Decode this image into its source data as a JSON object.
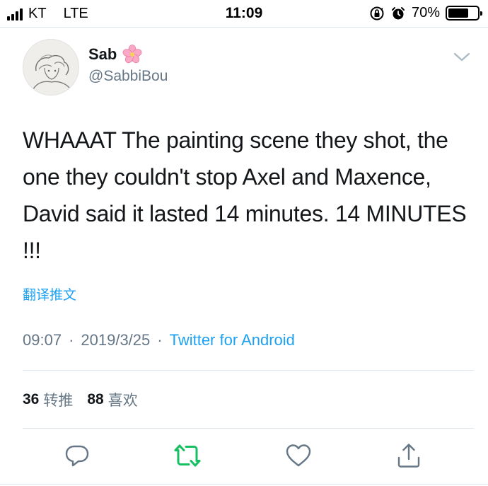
{
  "status_bar": {
    "carrier": "KT",
    "network": "LTE",
    "time": "11:09",
    "battery_percent": "70%",
    "battery_level": 0.7
  },
  "tweet": {
    "display_name": "Sab",
    "name_emoji_icon": "cherry-blossom-icon",
    "handle": "@SabbiBou",
    "text": "WHAAAT The painting scene they shot, the one they couldn't stop Axel and Maxence, David said it lasted 14 minutes. 14 MINUTES !!!",
    "translate_label": "翻译推文",
    "time": "09:07",
    "date": "2019/3/25",
    "separator": "·",
    "source": "Twitter for Android",
    "retweet_count": "36",
    "retweet_label": "转推",
    "like_count": "88",
    "like_label": "喜欢"
  },
  "colors": {
    "accent_blue": "#1da1f2",
    "retweet_green": "#17bf63",
    "secondary_text": "#657786"
  },
  "actions": [
    "reply-icon",
    "retweet-icon",
    "like-icon",
    "share-icon"
  ]
}
